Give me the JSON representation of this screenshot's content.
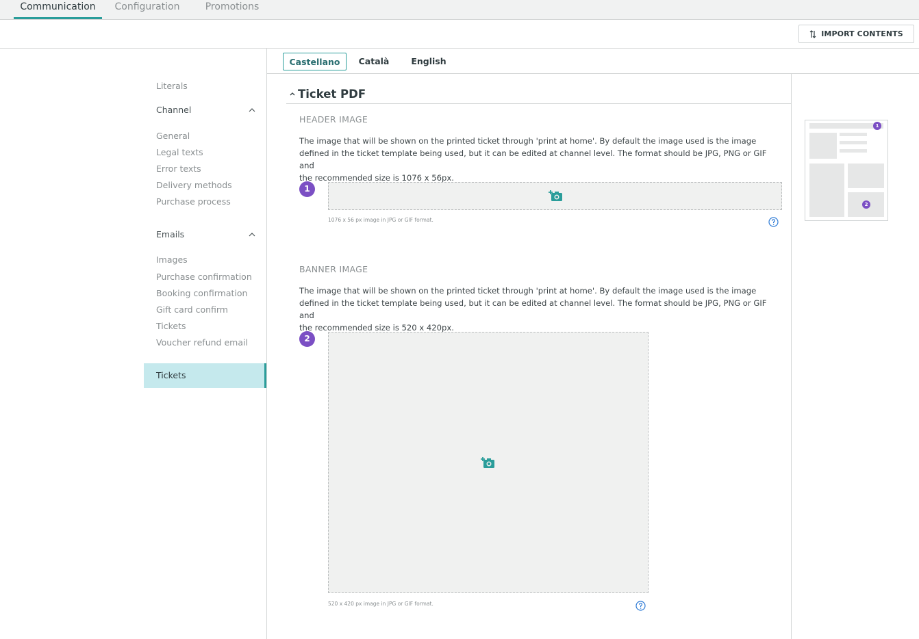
{
  "top_tabs": [
    {
      "label": "Communication",
      "active": true
    },
    {
      "label": "Configuration",
      "active": false
    },
    {
      "label": "Promotions",
      "active": false
    }
  ],
  "toolbar": {
    "import_label": "IMPORT CONTENTS",
    "import_icon": "sort-arrows-icon"
  },
  "sidebar": {
    "literals": "Literals",
    "channel": {
      "label": "Channel",
      "items": [
        "General",
        "Legal texts",
        "Error texts",
        "Delivery methods",
        "Purchase process"
      ]
    },
    "emails": {
      "label": "Emails",
      "items": [
        "Images",
        "Purchase confirmation",
        "Booking confirmation",
        "Gift card confirm",
        "Tickets",
        "Voucher refund email"
      ]
    },
    "active_item": "Tickets"
  },
  "languages": [
    {
      "label": "Castellano",
      "active": true
    },
    {
      "label": "Català",
      "active": false
    },
    {
      "label": "English",
      "active": false
    }
  ],
  "section": {
    "title": "Ticket PDF",
    "header_image": {
      "label": "HEADER IMAGE",
      "desc_lines": [
        "The image that will be shown on the printed ticket through 'print at home'. By default the image used is the image",
        "defined in the ticket template being used, but it can be edited at channel level. The format should be JPG, PNG or GIF and",
        "the recommended size is 1076 x 56px."
      ],
      "badge": "1",
      "hint": "1076 x 56 px image in JPG or GIF format."
    },
    "banner_image": {
      "label": "BANNER IMAGE",
      "desc_lines": [
        "The image that will be shown on the printed ticket through 'print at home'. By default the image used is the image",
        "defined in the ticket template being used, but it can be edited at channel level. The format should be JPG, PNG or GIF and",
        "the recommended size is 520 x 420px."
      ],
      "badge": "2",
      "hint": "520 x 420 px image in JPG or GIF format."
    }
  },
  "preview": {
    "badge_1": "1",
    "badge_2": "2"
  },
  "colors": {
    "accent": "#2a9d9a",
    "badge": "#7b4fc4",
    "active_bg": "#c5e9ed",
    "help": "#2e7bd6"
  }
}
